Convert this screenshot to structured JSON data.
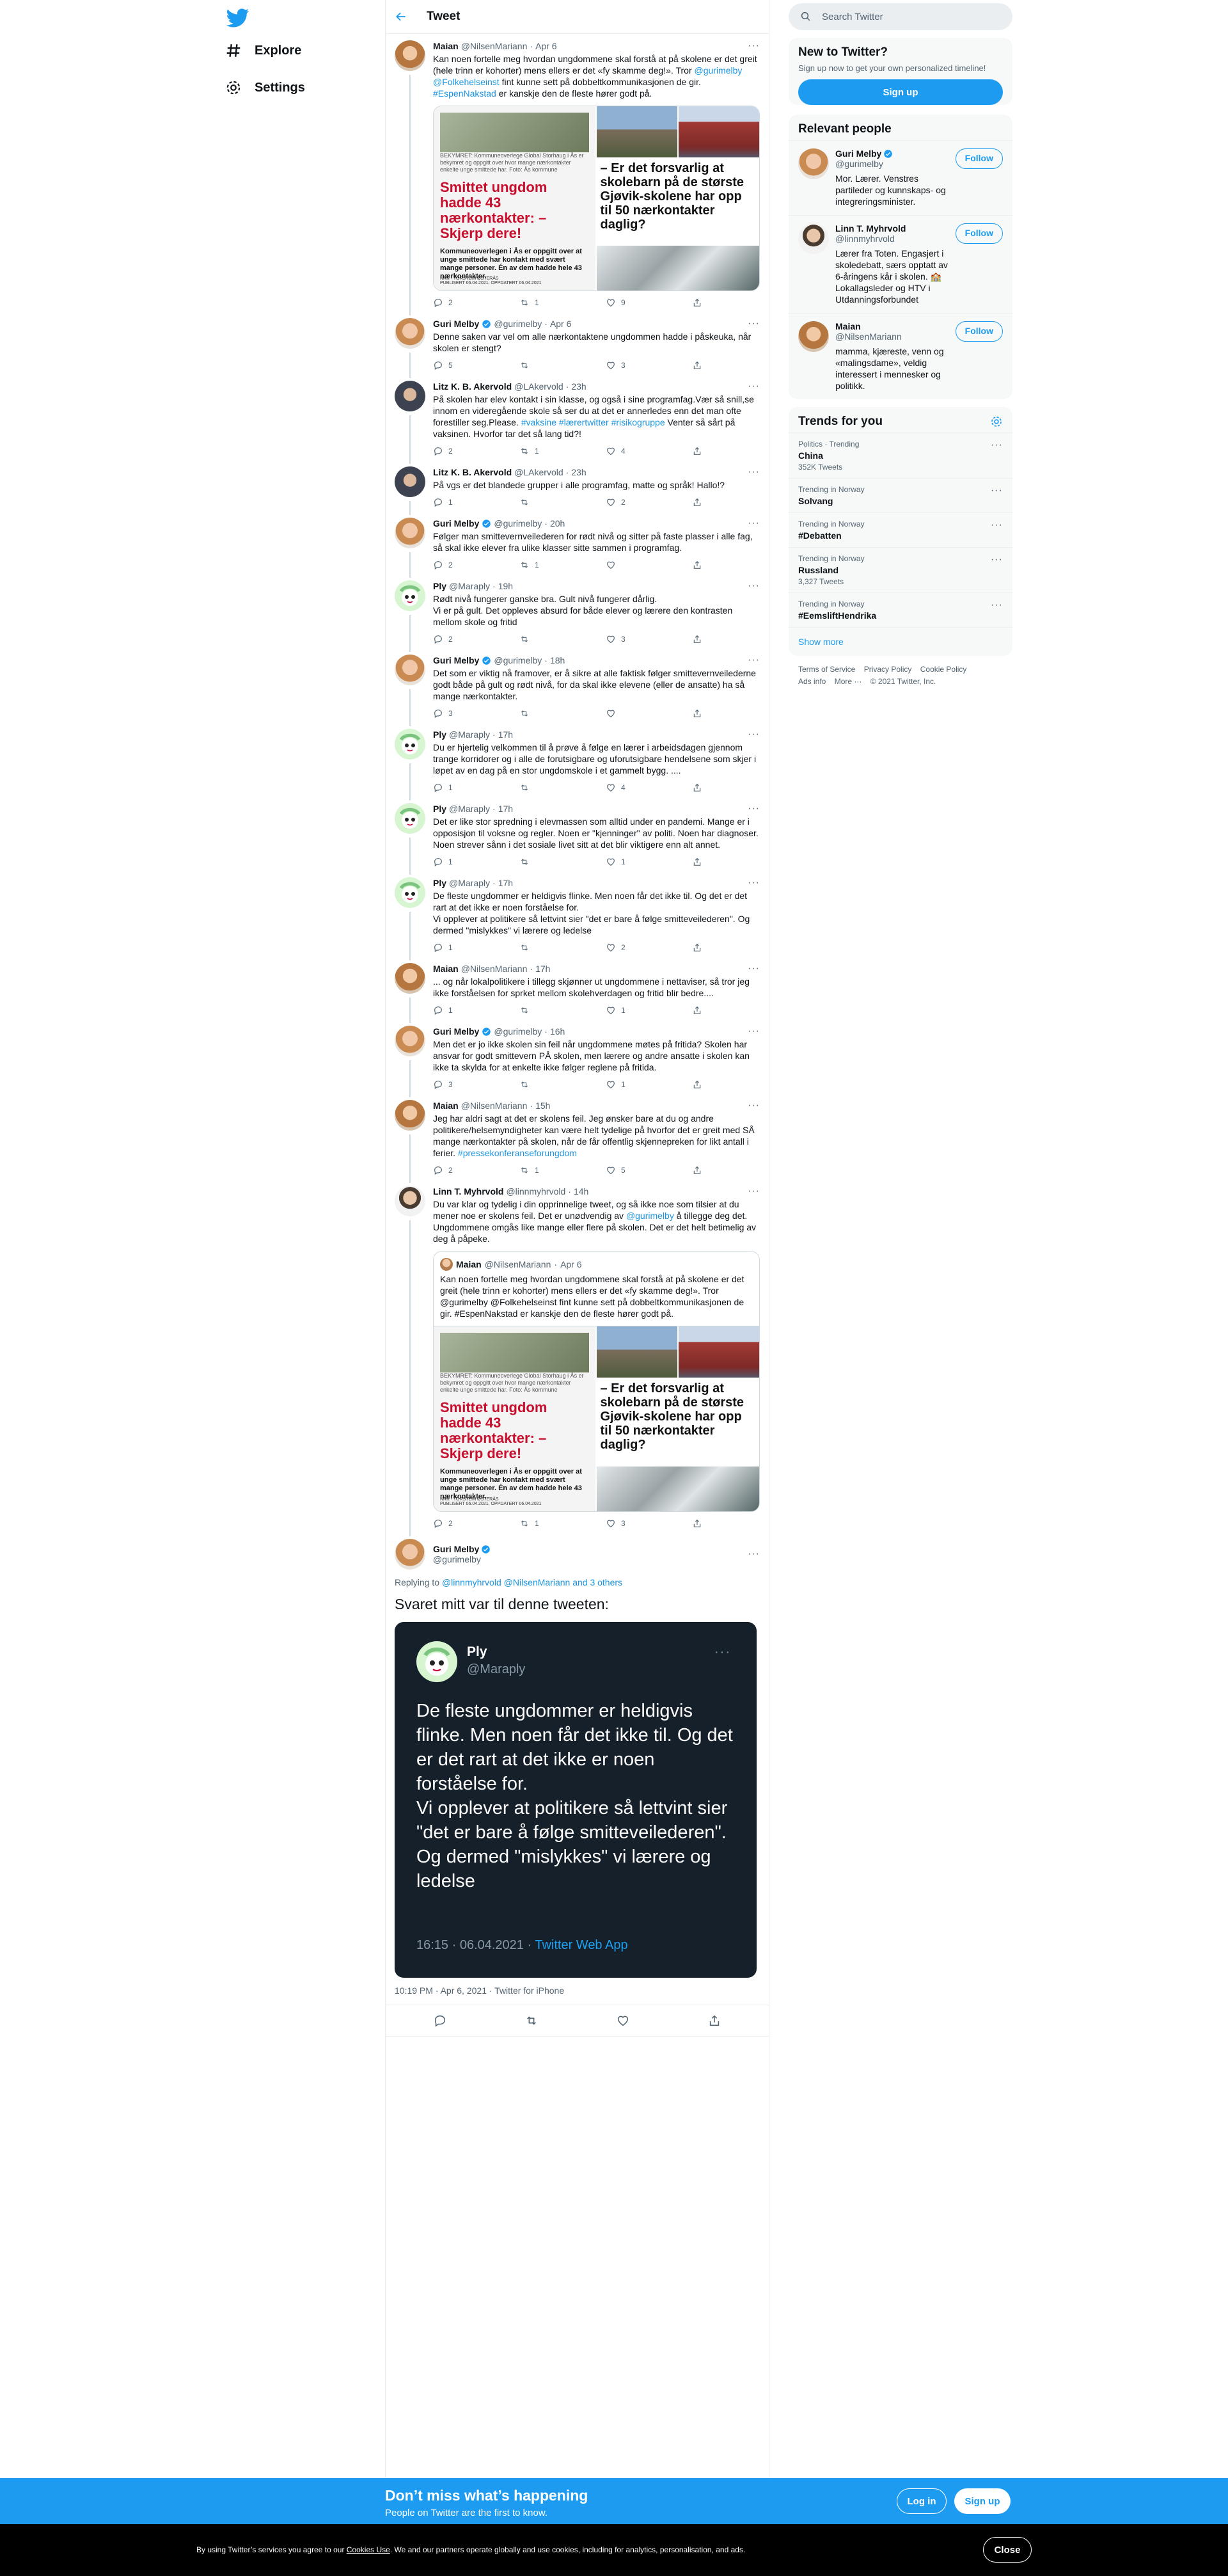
{
  "nav": {
    "explore": "Explore",
    "settings": "Settings"
  },
  "header": {
    "title": "Tweet"
  },
  "search": {
    "placeholder": "Search Twitter"
  },
  "signup_box": {
    "title": "New to Twitter?",
    "subtitle": "Sign up now to get your own personalized timeline!",
    "button": "Sign up"
  },
  "relevant": {
    "title": "Relevant people",
    "follow": "Follow",
    "people": [
      {
        "name": "Guri Melby",
        "handle": "@gurimelby",
        "bio": "Mor. Lærer. Venstres partileder og kunnskaps- og integreringsminister."
      },
      {
        "name": "Linn T. Myhrvold",
        "handle": "@linnmyhrvold",
        "bio": "Lærer fra Toten. Engasjert i skoledebatt, særs opptatt av 6-åringens kår i skolen. 🏫 Lokallagsleder og HTV i Utdanningsforbundet"
      },
      {
        "name": "Maian",
        "handle": "@NilsenMariann",
        "bio": "mamma, kjæreste, venn og «malingsdame», veldig interessert i mennesker og politikk."
      }
    ]
  },
  "trends": {
    "title": "Trends for you",
    "items": [
      {
        "context": "Politics · Trending",
        "name": "China",
        "count": "352K Tweets"
      },
      {
        "context": "Trending in Norway",
        "name": "Solvang",
        "count": ""
      },
      {
        "context": "Trending in Norway",
        "name": "#Debatten",
        "count": ""
      },
      {
        "context": "Trending in Norway",
        "name": "Russland",
        "count": "3,327 Tweets"
      },
      {
        "context": "Trending in Norway",
        "name": "#EemsliftHendrika",
        "count": ""
      }
    ],
    "show_more": "Show more"
  },
  "footer": {
    "terms": "Terms of Service",
    "privacy": "Privacy Policy",
    "cookie": "Cookie Policy",
    "ads": "Ads info",
    "more": "More ···",
    "copyright": "© 2021 Twitter, Inc."
  },
  "news_card": {
    "left_small": "BEKYMRET: Kommuneoverlege Global Storhaug i Ås er bekymret og oppgitt over hvor mange nærkontakter enkelte unge smittede har. Foto: Ås kommune",
    "left_big": "Smittet ungdom hadde 43 nærkontakter: – Skjerp dere!",
    "left_lead": "Kommuneoverlegen i Ås er oppgitt over at unge smittede har kontakt med svært mange personer. Én av dem hadde hele 43 nærkontakter.",
    "left_foot1": "NRK · TORSTEIN ØSTERÅS",
    "left_foot2": "PUBLISERT 06.04.2021, OPPDATERT 06.04.2021",
    "right_headline": "– Er det forsvarlig at skolebarn på de største Gjøvik-skolene har opp til 50 nærkontakter daglig?"
  },
  "tweets": [
    {
      "name": "Maian",
      "handle": "@NilsenMariann",
      "time": "Apr 6",
      "text": "Kan noen fortelle meg hvordan ungdommene skal forstå at på skolene er det greit (hele trinn er kohorter) mens ellers er det «fy skamme deg!». Tror @gurimelby @Folkehelseinst fint kunne sett på dobbeltkommunikasjonen de gir. #EspenNakstad er kanskje den de fleste hører godt på.",
      "replies": "2",
      "retweets": "1",
      "likes": "9"
    },
    {
      "name": "Guri Melby",
      "handle": "@gurimelby",
      "time": "Apr 6",
      "text": "Denne saken var vel om alle nærkontaktene ungdommen hadde i påskeuka, når skolen er stengt?",
      "replies": "5",
      "retweets": "",
      "likes": "3"
    },
    {
      "name": "Litz K. B. Akervold",
      "handle": "@LAkervold",
      "time": "23h",
      "text": "På skolen har elev kontakt i sin klasse, og også i sine programfag.Vær så snill,se innom en videregående skole så ser du at det er annerledes enn det man ofte forestiller seg.Please. #vaksine #lærertwitter #risikogruppe Venter så sårt på vaksinen. Hvorfor tar det så lang tid?!",
      "replies": "2",
      "retweets": "1",
      "likes": "4"
    },
    {
      "name": "Litz K. B. Akervold",
      "handle": "@LAkervold",
      "time": "23h",
      "text": "På vgs er det blandede grupper i alle programfag, matte og språk! Hallo!?",
      "replies": "1",
      "retweets": "",
      "likes": "2"
    },
    {
      "name": "Guri Melby",
      "handle": "@gurimelby",
      "time": "20h",
      "text": "Følger man smittevernveilederen for rødt nivå og sitter på faste plasser i alle fag, så skal ikke elever fra ulike klasser sitte sammen i programfag.",
      "replies": "2",
      "retweets": "1",
      "likes": ""
    },
    {
      "name": "Ply",
      "handle": "@Maraply",
      "time": "19h",
      "text": "Rødt nivå fungerer ganske bra. Gult nivå fungerer dårlig.\nVi er på gult. Det oppleves absurd for både elever og lærere den kontrasten mellom skole og fritid",
      "replies": "2",
      "retweets": "",
      "likes": "3"
    },
    {
      "name": "Guri Melby",
      "handle": "@gurimelby",
      "time": "18h",
      "text": "Det som er viktig nå framover, er å sikre at alle faktisk følger smittevernveilederne godt både på gult og rødt nivå, for da skal ikke elevene (eller de ansatte) ha så mange nærkontakter.",
      "replies": "3",
      "retweets": "",
      "likes": ""
    },
    {
      "name": "Ply",
      "handle": "@Maraply",
      "time": "17h",
      "text": "Du er hjertelig velkommen til å prøve å følge en lærer i arbeidsdagen gjennom trange korridorer og i alle de forutsigbare og uforutsigbare hendelsene som skjer i løpet av en dag på en stor ungdomskole i et gammelt bygg. ....",
      "replies": "1",
      "retweets": "",
      "likes": "4"
    },
    {
      "name": "Ply",
      "handle": "@Maraply",
      "time": "17h",
      "text": "Det er like stor spredning i elevmassen som alltid under en pandemi. Mange er i opposisjon til voksne og regler. Noen er \"kjenninger\" av politi. Noen har diagnoser. Noen strever sånn i det sosiale livet sitt at det blir viktigere enn alt annet.",
      "replies": "1",
      "retweets": "",
      "likes": "1"
    },
    {
      "name": "Ply",
      "handle": "@Maraply",
      "time": "17h",
      "text": "De fleste ungdommer er heldigvis flinke. Men noen får det ikke til. Og det er det rart at det ikke er noen forståelse for.\nVi opplever at politikere så  lettvint sier \"det er bare å følge smitteveilederen\". Og dermed \"mislykkes\" vi lærere og ledelse",
      "replies": "1",
      "retweets": "",
      "likes": "2"
    },
    {
      "name": "Maian",
      "handle": "@NilsenMariann",
      "time": "17h",
      "text": "... og når lokalpolitikere i tillegg skjønner ut ungdommene i nettaviser, så tror jeg ikke forståelsen for sprket mellom skolehverdagen og fritid blir bedre....",
      "replies": "1",
      "retweets": "",
      "likes": "1"
    },
    {
      "name": "Guri Melby",
      "handle": "@gurimelby",
      "time": "16h",
      "text": "Men det er jo ikke skolen sin feil når ungdommene møtes på fritida? Skolen har ansvar for godt smittevern PÅ skolen, men lærere og andre ansatte i skolen kan ikke ta skylda for at enkelte ikke følger reglene på fritida.",
      "replies": "3",
      "retweets": "",
      "likes": "1"
    },
    {
      "name": "Maian",
      "handle": "@NilsenMariann",
      "time": "15h",
      "text": "Jeg har aldri sagt at det er skolens feil.  Jeg ønsker bare at du og andre politikere/helsemyndigheter kan være helt tydelige på hvorfor det er greit med SÅ mange nærkontakter på skolen, når de får offentlig skjennepreken for likt antall i ferier. #pressekonferanseforungdom",
      "replies": "2",
      "retweets": "1",
      "likes": "5"
    },
    {
      "name": "Linn T. Myhrvold",
      "handle": "@linnmyhrvold",
      "time": "14h",
      "text": "Du var klar og tydelig i din opprinnelige tweet, og så ikke noe som tilsier at du mener noe er skolens feil. Det er unødvendig av @gurimelby å tillegge deg det. Ungdommene omgås like mange eller flere på skolen. Det er det helt betimelig av deg å påpeke.",
      "replies": "2",
      "retweets": "1",
      "likes": "3"
    }
  ],
  "quoted": {
    "name": "Maian",
    "handle": "@NilsenMariann",
    "time": "Apr 6",
    "text": "Kan noen fortelle meg hvordan ungdommene skal forstå at på skolene er det greit (hele trinn er kohorter) mens ellers er det «fy skamme deg!». Tror @gurimelby  @Folkehelseinst fint kunne sett på dobbeltkommunikasjonen de gir. #EspenNakstad er kanskje den de fleste hører godt på."
  },
  "focal": {
    "name": "Guri Melby",
    "handle": "@gurimelby",
    "replying_prefix": "Replying to",
    "replying_to": "@linnmyhrvold @NilsenMariann and 3 others",
    "text": "Svaret mitt var til denne tweeten:",
    "shot_name": "Ply",
    "shot_handle": "@Maraply",
    "shot_text": "De fleste ungdommer er heldigvis flinke. Men noen får det ikke til. Og det er det rart at det ikke er noen forståelse for.\nVi opplever at politikere så  lettvint sier \"det er bare å følge smitteveilederen\". Og dermed \"mislykkes\" vi lærere og ledelse",
    "shot_time": "16:15 · 06.04.2021 ·",
    "shot_app": "Twitter Web App",
    "meta_time": "10:19 PM · Apr 6, 2021 ·",
    "meta_app": "Twitter for iPhone"
  },
  "bottombar": {
    "title": "Don’t miss what’s happening",
    "subtitle": "People on Twitter are the first to know.",
    "login": "Log in",
    "signup": "Sign up"
  },
  "cookie": {
    "pre": "By using Twitter’s services you agree to our",
    "link": "Cookies Use",
    "post": ". We and our partners operate globally and use cookies, including for analytics, personalisation, and ads.",
    "close": "Close"
  },
  "colors": {
    "accent": "#1d9bf0",
    "text": "#0f1419",
    "muted": "#536471"
  }
}
